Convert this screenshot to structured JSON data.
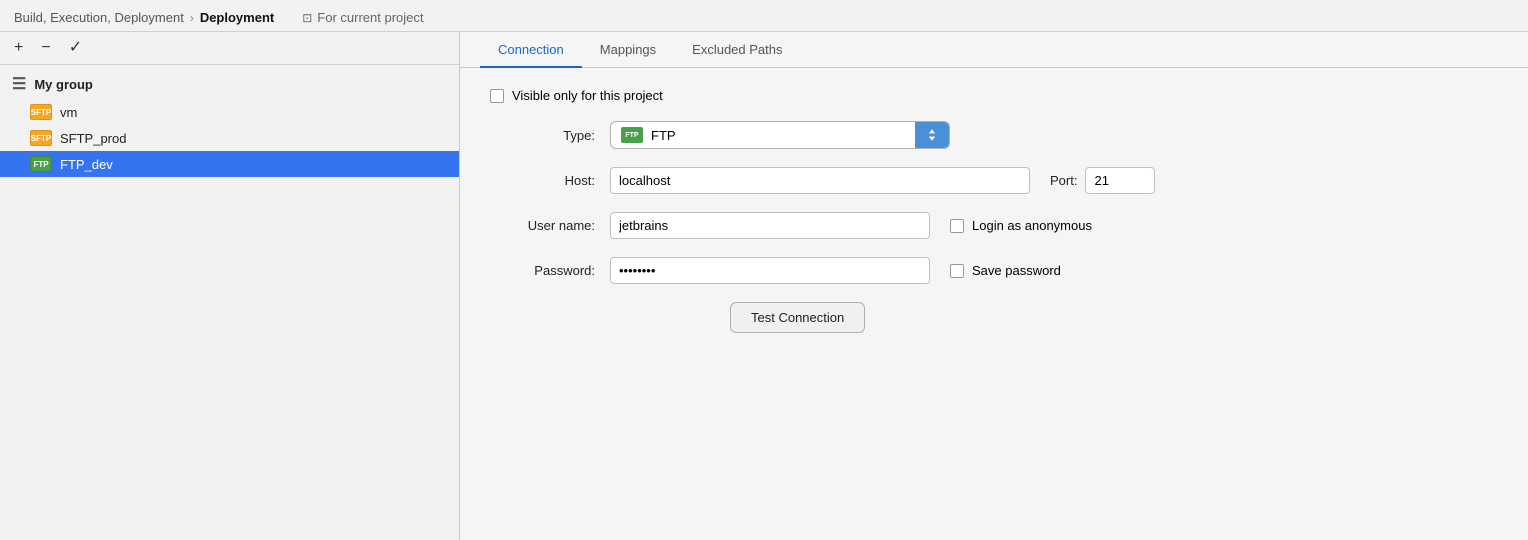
{
  "header": {
    "breadcrumb_parent": "Build, Execution, Deployment",
    "breadcrumb_separator": "›",
    "breadcrumb_current": "Deployment",
    "for_project_label": "For current project",
    "for_project_icon": "🗎"
  },
  "sidebar": {
    "toolbar": {
      "add_label": "+",
      "remove_label": "−",
      "check_label": "✓"
    },
    "group_item": {
      "icon": "≡",
      "label": "My group"
    },
    "items": [
      {
        "id": "vm",
        "type": "sftp",
        "label": "vm",
        "selected": false
      },
      {
        "id": "sftp_prod",
        "type": "sftp",
        "label": "SFTP_prod",
        "selected": false
      },
      {
        "id": "ftp_dev",
        "type": "ftp",
        "label": "FTP_dev",
        "selected": true
      }
    ]
  },
  "tabs": [
    {
      "id": "connection",
      "label": "Connection",
      "active": true
    },
    {
      "id": "mappings",
      "label": "Mappings",
      "active": false
    },
    {
      "id": "excluded_paths",
      "label": "Excluded Paths",
      "active": false
    }
  ],
  "form": {
    "visible_only_label": "Visible only for this project",
    "type_label": "Type:",
    "type_value": "FTP",
    "host_label": "Host:",
    "host_value": "localhost",
    "port_label": "Port:",
    "port_value": "21",
    "username_label": "User name:",
    "username_value": "jetbrains",
    "login_anonymous_label": "Login as anonymous",
    "password_label": "Password:",
    "password_value": "••••••••",
    "save_password_label": "Save password",
    "test_connection_label": "Test Connection"
  }
}
